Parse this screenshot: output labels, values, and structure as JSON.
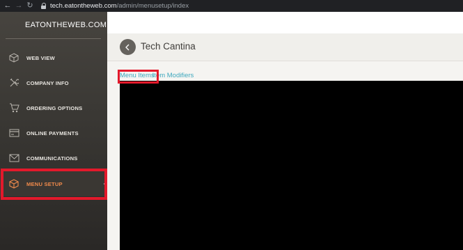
{
  "browser": {
    "url_host": "tech.eatontheweb.com",
    "url_path": "/admin/menusetup/index"
  },
  "sidebar": {
    "brand": "EATONTHEWEB.COM",
    "items": [
      {
        "label": "WEB VIEW",
        "icon": "cube-icon"
      },
      {
        "label": "COMPANY INFO",
        "icon": "tools-icon"
      },
      {
        "label": "ORDERING OPTIONS",
        "icon": "cart-icon"
      },
      {
        "label": "ONLINE PAYMENTS",
        "icon": "card-icon"
      },
      {
        "label": "COMMUNICATIONS",
        "icon": "envelope-icon"
      },
      {
        "label": "MENU SETUP",
        "icon": "box-icon",
        "active": true
      }
    ]
  },
  "header": {
    "title": "Tech Cantina"
  },
  "tabs": {
    "menu_items": "Menu Items",
    "item_modifiers": "Item Modifiers"
  },
  "colors": {
    "accent": "#f08a4b",
    "link": "#3ea8be",
    "highlight": "#e3192b",
    "sidebar": "#3b3935"
  }
}
